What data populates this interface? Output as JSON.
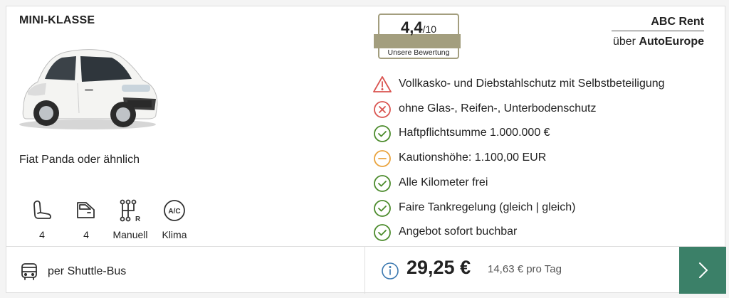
{
  "car": {
    "category": "MINI-KLASSE",
    "model": "Fiat Panda oder ähnlich",
    "image_icon": "white-compact-car-image"
  },
  "features": [
    {
      "icon": "seat-icon",
      "label": "4"
    },
    {
      "icon": "door-icon",
      "label": "4"
    },
    {
      "icon": "manual-gearbox-icon",
      "label": "Manuell"
    },
    {
      "icon": "ac-icon",
      "label": "Klima",
      "icon_text": "A/C"
    }
  ],
  "rating": {
    "value": "4,4",
    "max": "/10",
    "label": "Unsere Bewertung",
    "color": "#a39e7e"
  },
  "provider": {
    "name": "ABC Rent",
    "via_prefix": "über",
    "via_name": "AutoEurope"
  },
  "conditions": [
    {
      "status": "warning",
      "icon": "warning-triangle-icon",
      "text": "Vollkasko- und Diebstahlschutz mit Selbstbeteiligung"
    },
    {
      "status": "negative",
      "icon": "x-circle-icon",
      "text": "ohne Glas-, Reifen-, Unterbodenschutz"
    },
    {
      "status": "positive",
      "icon": "check-circle-icon",
      "text": "Haftpflichtsumme 1.000.000 €"
    },
    {
      "status": "neutral",
      "icon": "minus-circle-icon",
      "text": "Kautionshöhe: 1.100,00 EUR"
    },
    {
      "status": "positive",
      "icon": "check-circle-icon",
      "text": "Alle Kilometer frei"
    },
    {
      "status": "positive",
      "icon": "check-circle-icon",
      "text": "Faire Tankregelung (gleich | gleich)"
    },
    {
      "status": "positive",
      "icon": "check-circle-icon",
      "text": "Angebot sofort buchbar"
    }
  ],
  "status_colors": {
    "warning": "#d9534f",
    "negative": "#d9534f",
    "positive": "#4a8a2a",
    "neutral": "#e9a23b"
  },
  "transfer": {
    "icon": "bus-icon",
    "text": "per Shuttle-Bus"
  },
  "price": {
    "total": "29,25 €",
    "per_day": "14,63 € pro Tag",
    "info_icon": "info-icon",
    "info_color": "#3a78b0"
  },
  "cta": {
    "icon": "chevron-right-icon",
    "color": "#3b8068"
  }
}
